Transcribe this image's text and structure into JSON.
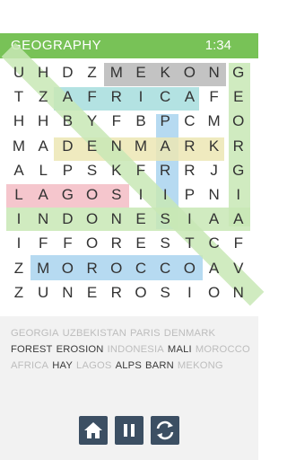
{
  "header": {
    "title": "GEOGRAPHY",
    "timer": "1:34"
  },
  "grid": {
    "rows": [
      "UHDZMEKONG",
      "TZAFRICAFE",
      "HHBYFBPCMO",
      "MADENMARKR",
      "ALPSKFRRJG",
      "LAGOSIIPNI",
      "INDONESIAA",
      "IFFORESTCF",
      "ZMOROCCOAV",
      "ZUNEROSION"
    ]
  },
  "highlights": [
    {
      "word": "MEKONG",
      "color": "#b9b9b9"
    },
    {
      "word": "AFRICA",
      "color": "#a6dddd"
    },
    {
      "word": "DENMARK",
      "color": "#ece6b4"
    },
    {
      "word": "PARIS",
      "color": "#a9d3ee"
    },
    {
      "word": "LAGOS",
      "color": "#f3bcc4"
    },
    {
      "word": "INDONESIA",
      "color": "#c8e8b5"
    },
    {
      "word": "MOROCCO",
      "color": "#a9d3ee"
    },
    {
      "word": "GEORGIA",
      "color": "#c8e8b5"
    },
    {
      "word": "UZBEKISTAN",
      "color": "#c8e8b5"
    }
  ],
  "wordbank": {
    "words": [
      {
        "label": "GEORGIA",
        "found": true
      },
      {
        "label": "UZBEKISTAN",
        "found": true
      },
      {
        "label": "PARIS",
        "found": true
      },
      {
        "label": "DENMARK",
        "found": true
      },
      {
        "label": "FOREST",
        "found": false
      },
      {
        "label": "EROSION",
        "found": false
      },
      {
        "label": "INDONESIA",
        "found": true
      },
      {
        "label": "MALI",
        "found": false
      },
      {
        "label": "MOROCCO",
        "found": true
      },
      {
        "label": "AFRICA",
        "found": true
      },
      {
        "label": "HAY",
        "found": false
      },
      {
        "label": "LAGOS",
        "found": true
      },
      {
        "label": "ALPS",
        "found": false
      },
      {
        "label": "BARN",
        "found": false
      },
      {
        "label": "MEKONG",
        "found": true
      }
    ]
  },
  "controls": {
    "home_icon": "home-icon",
    "pause_icon": "pause-icon",
    "restart_icon": "restart-icon"
  }
}
